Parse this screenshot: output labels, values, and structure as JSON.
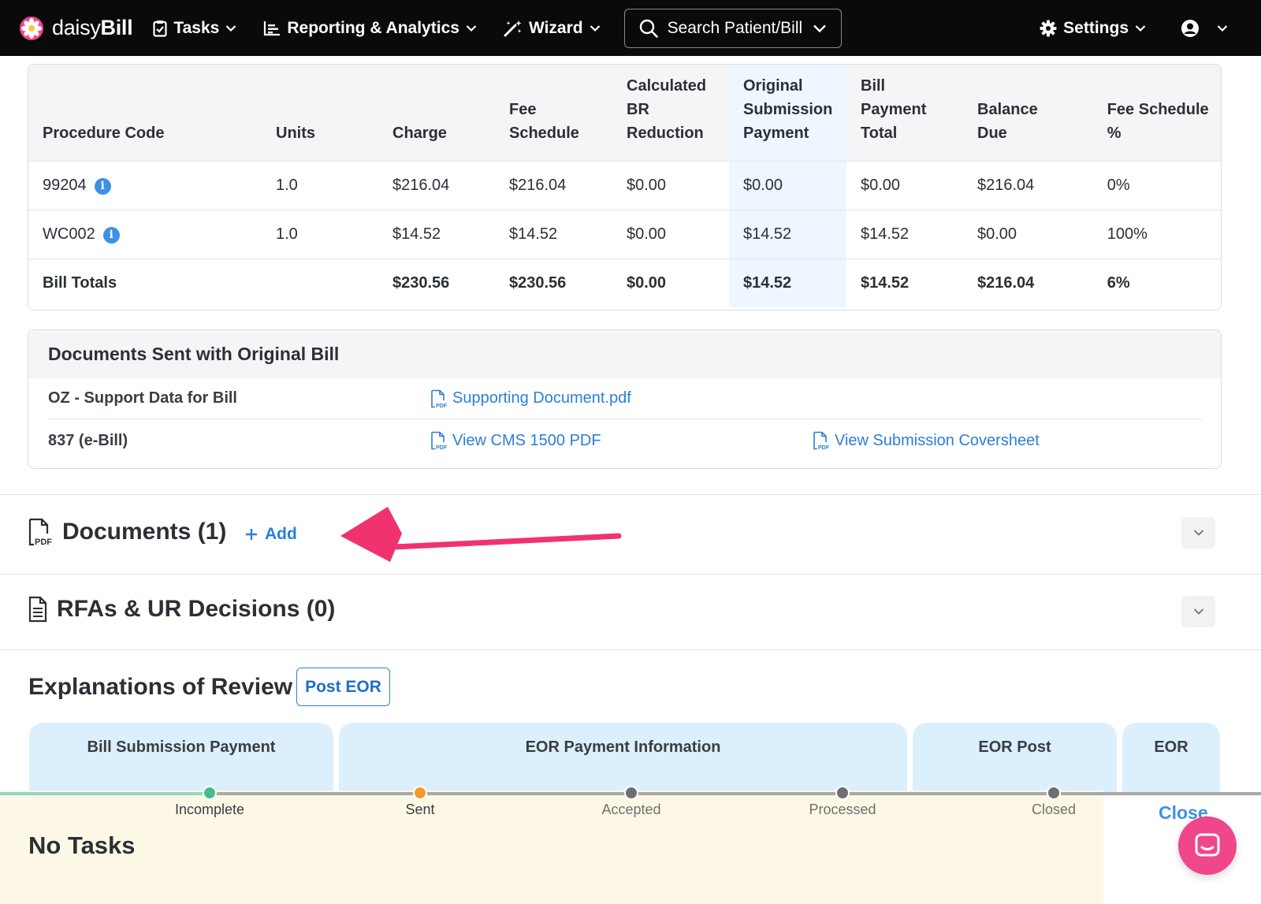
{
  "nav": {
    "logo_prefix": "daisy",
    "logo_suffix": "Bill",
    "tasks": "Tasks",
    "reporting": "Reporting & Analytics",
    "wizard": "Wizard",
    "search_placeholder": "Search Patient/Bill",
    "settings": "Settings"
  },
  "procedure_table": {
    "headers": [
      "Procedure Code",
      "Units",
      "Charge",
      "Fee Schedule",
      "Calculated BR Reduction",
      "Original Submission Payment",
      "Bill Payment Total",
      "Balance Due",
      "Fee Schedule %"
    ],
    "rows": [
      [
        "99204",
        "1.0",
        "$216.04",
        "$216.04",
        "$0.00",
        "$0.00",
        "$0.00",
        "$216.04",
        "0%"
      ],
      [
        "WC002",
        "1.0",
        "$14.52",
        "$14.52",
        "$0.00",
        "$14.52",
        "$14.52",
        "$0.00",
        "100%"
      ]
    ],
    "totals": [
      "Bill Totals",
      "",
      "$230.56",
      "$230.56",
      "$0.00",
      "$14.52",
      "$14.52",
      "$216.04",
      "6%"
    ]
  },
  "documents_sent": {
    "title": "Documents Sent with Original Bill",
    "rows": [
      {
        "label": "OZ - Support Data for Bill",
        "links": [
          "Supporting Document.pdf"
        ]
      },
      {
        "label": "837 (e-Bill)",
        "links": [
          "View CMS 1500 PDF",
          "View Submission Coversheet"
        ]
      }
    ]
  },
  "documents_section": {
    "title": "Documents (1)",
    "add_label": "Add"
  },
  "rfa_section": {
    "title": "RFAs & UR Decisions (0)"
  },
  "eor": {
    "title": "Explanations of Review",
    "post_button": "Post EOR",
    "columns": [
      "Bill Submission Payment",
      "EOR Payment Information",
      "EOR Post",
      "EOR"
    ]
  },
  "status": {
    "steps": [
      "Incomplete",
      "Sent",
      "Accepted",
      "Processed",
      "Closed"
    ],
    "no_tasks": "No Tasks",
    "close_label": "Close"
  },
  "colors": {
    "accent": "#2b7fd9",
    "arrow": "#f0336e",
    "chat": "#f0468a",
    "nav_bg": "#0a0a0a"
  }
}
